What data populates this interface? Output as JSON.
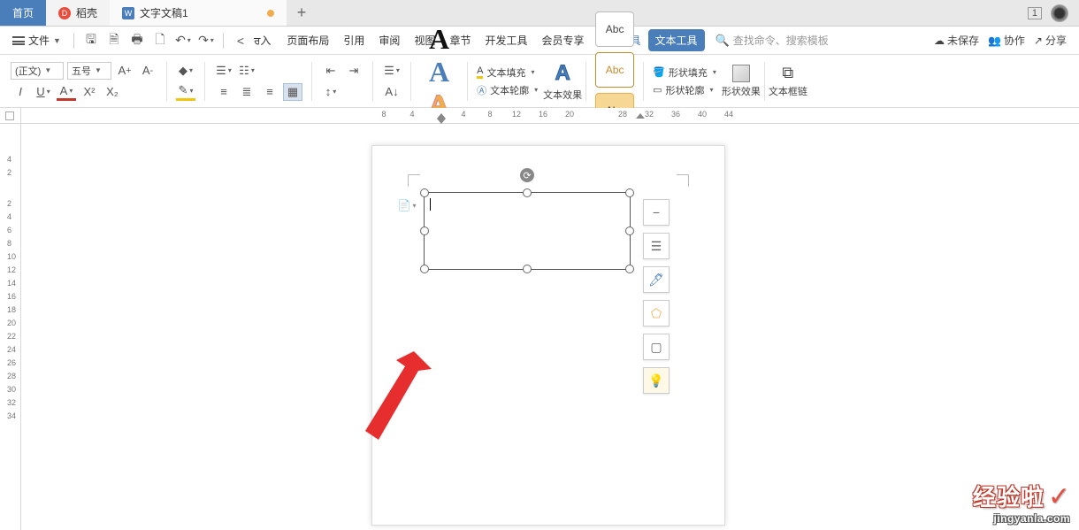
{
  "title_bar": {
    "home_tab": "首页",
    "docer_tab": "稻壳",
    "doc_tab": "文字文稿1",
    "new_tab": "+",
    "window_num": "1"
  },
  "menu_bar": {
    "file": "文件",
    "insert_short": "插入",
    "insert_char": "ジ入",
    "tabs": {
      "page_layout": "页面布局",
      "reference": "引用",
      "review": "审阅",
      "view": "视图",
      "chapter": "章节",
      "dev_tools": "开发工具",
      "member": "会员专享",
      "drawing": "绘图工具",
      "text_tool": "文本工具"
    },
    "search_placeholder": "查找命令、搜索模板",
    "unsaved": "未保存",
    "collab": "协作",
    "share": "分享"
  },
  "ribbon": {
    "style_combo": "(正文)",
    "size_combo": "五号",
    "text_fill": "文本填充",
    "text_outline": "文本轮廓",
    "text_effect": "文本效果",
    "abc": "Abc",
    "shape_fill": "形状填充",
    "shape_outline": "形状轮廓",
    "shape_effect": "形状效果",
    "text_frame_link": "文本框链"
  },
  "ruler_h": [
    "8",
    "4",
    "4",
    "8",
    "12",
    "16",
    "20",
    "28",
    "32",
    "36",
    "40",
    "44"
  ],
  "ruler_v": [
    "4",
    "2",
    "2",
    "4",
    "6",
    "8",
    "10",
    "12",
    "14",
    "16",
    "18",
    "20",
    "22",
    "24",
    "26",
    "28",
    "30",
    "32",
    "34"
  ],
  "watermark": {
    "line1": "经验啦",
    "line2": "jingyanla.com"
  }
}
